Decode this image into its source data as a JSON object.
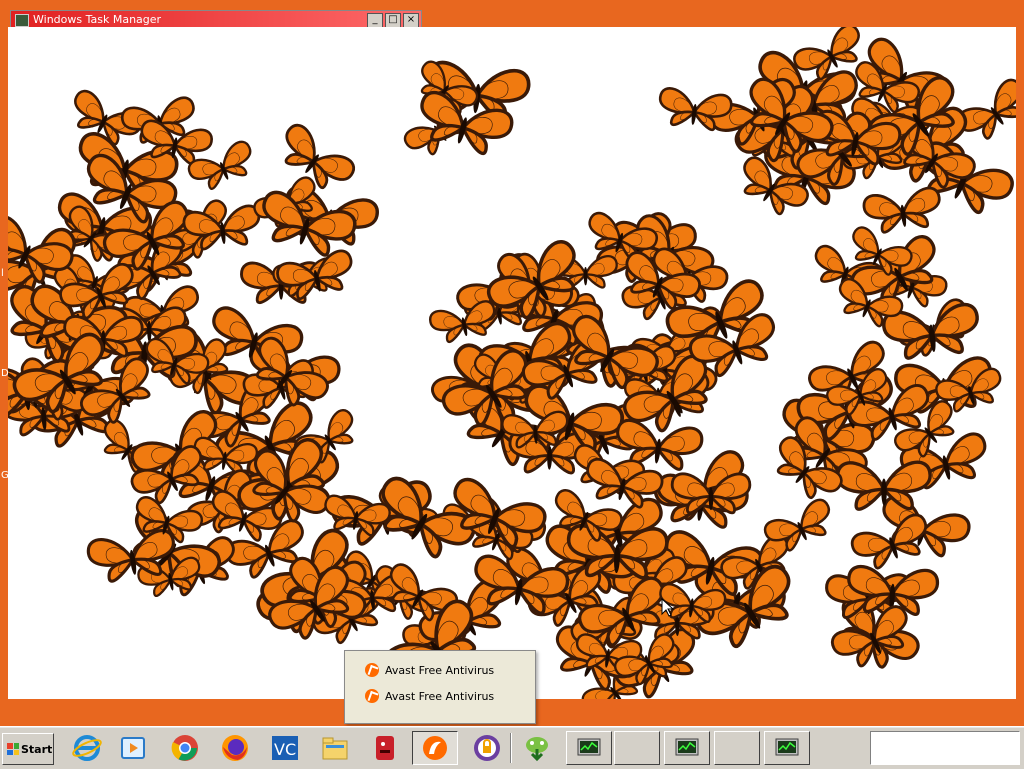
{
  "background_window": {
    "title": "Windows Task Manager",
    "buttons": [
      "_",
      "□",
      "×"
    ]
  },
  "desktop": {
    "edge_fragments": [
      "l",
      "D",
      "G"
    ],
    "content": "Monarch butterfly image viewer / screensaver window"
  },
  "popup_menu": {
    "items": [
      {
        "label": "Avast Free Antivirus",
        "icon": "avast-icon"
      },
      {
        "label": "Avast Free Antivirus",
        "icon": "avast-icon"
      }
    ]
  },
  "taskbar": {
    "start_label": "Start",
    "pinned_icons": [
      "internet-explorer-icon",
      "windows-media-player-icon",
      "chrome-icon",
      "firefox-icon",
      "veracrypt-icon",
      "file-explorer-icon",
      "red-app-icon",
      "avast-icon",
      "avast-secureline-icon",
      "download-manager-icon"
    ],
    "window_buttons": [
      {
        "icon": "task-manager-icon"
      },
      {
        "icon": "blank"
      },
      {
        "icon": "task-manager-icon"
      },
      {
        "icon": "blank"
      },
      {
        "icon": "task-manager-icon"
      }
    ],
    "tray": ""
  },
  "colors": {
    "desktop_bg": "#e8671f",
    "butterfly_orange": "#f07a10",
    "butterfly_dark": "#3a1a08",
    "popup_bg": "#ece9d8",
    "taskbar_bg": "#d4d0c8"
  }
}
